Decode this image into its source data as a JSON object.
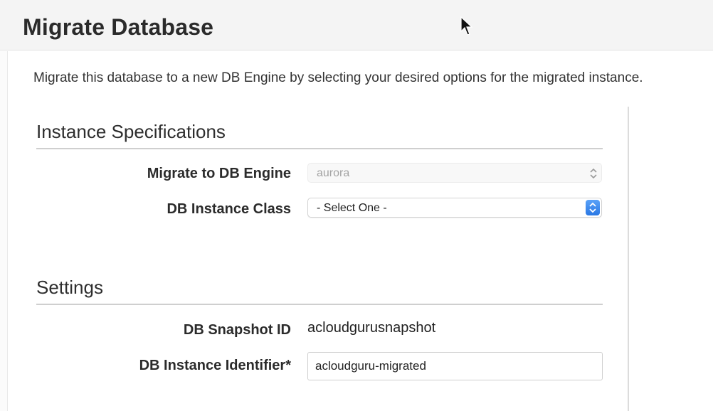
{
  "page": {
    "title": "Migrate Database",
    "description": "Migrate this database to a new DB Engine by selecting your desired options for the migrated instance."
  },
  "instance_specifications": {
    "heading": "Instance Specifications",
    "engine": {
      "label": "Migrate to DB Engine",
      "value": "aurora",
      "disabled": true
    },
    "instance_class": {
      "label": "DB Instance Class",
      "value": "- Select One -"
    }
  },
  "settings": {
    "heading": "Settings",
    "snapshot": {
      "label": "DB Snapshot ID",
      "value": "acloudgurusnapshot"
    },
    "identifier": {
      "label": "DB Instance Identifier*",
      "value": "acloudguru-migrated"
    }
  },
  "colors": {
    "select_accent": "#2a78e4",
    "divider": "#cfcfcf"
  },
  "icons": {
    "cursor": "mouse-pointer-icon",
    "select_arrows": "up-down-chevron-icon"
  }
}
